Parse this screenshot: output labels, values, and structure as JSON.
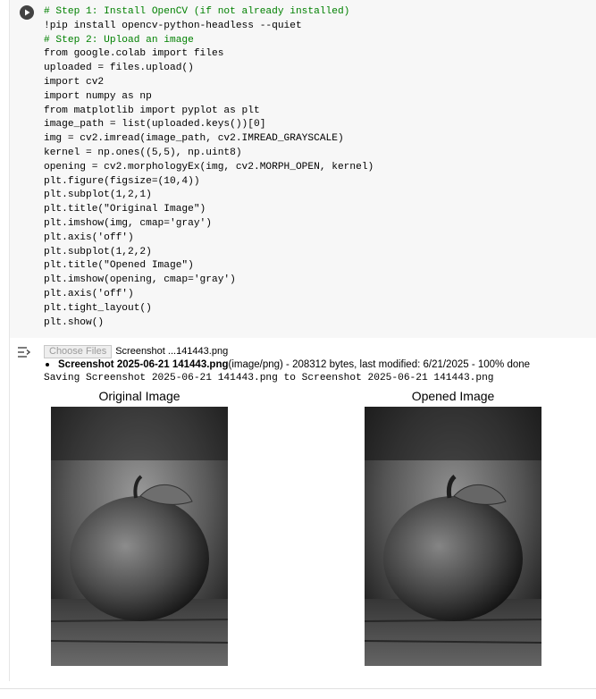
{
  "code_lines": [
    "# Step 1: Install OpenCV (if not already installed)",
    "!pip install opencv-python-headless --quiet",
    "# Step 2: Upload an image",
    "from google.colab import files",
    "uploaded = files.upload()",
    "import cv2",
    "import numpy as np",
    "from matplotlib import pyplot as plt",
    "image_path = list(uploaded.keys())[0]",
    "img = cv2.imread(image_path, cv2.IMREAD_GRAYSCALE)",
    "kernel = np.ones((5,5), np.uint8)",
    "opening = cv2.morphologyEx(img, cv2.MORPH_OPEN, kernel)",
    "plt.figure(figsize=(10,4))",
    "plt.subplot(1,2,1)",
    "plt.title(\"Original Image\")",
    "plt.imshow(img, cmap='gray')",
    "plt.axis('off')",
    "plt.subplot(1,2,2)",
    "plt.title(\"Opened Image\")",
    "plt.imshow(opening, cmap='gray')",
    "plt.axis('off')",
    "plt.tight_layout()",
    "plt.show()"
  ],
  "output": {
    "choose_files_label": "Choose Files",
    "chosen_file": "Screenshot ...141443.png",
    "uploaded_name": "Screenshot 2025-06-21 141443.png",
    "uploaded_meta": "(image/png) - 208312 bytes, last modified: 6/21/2025 - 100% done",
    "saving_line": "Saving Screenshot 2025-06-21 141443.png to Screenshot 2025-06-21 141443.png"
  },
  "figures": {
    "left_title": "Original Image",
    "right_title": "Opened Image"
  },
  "icons": {
    "run": "play-icon",
    "output": "output-toggle-icon"
  },
  "colors": {
    "comment": "#008000",
    "keyword": "#7a1fa2",
    "string": "#a31515",
    "number": "#098658"
  }
}
